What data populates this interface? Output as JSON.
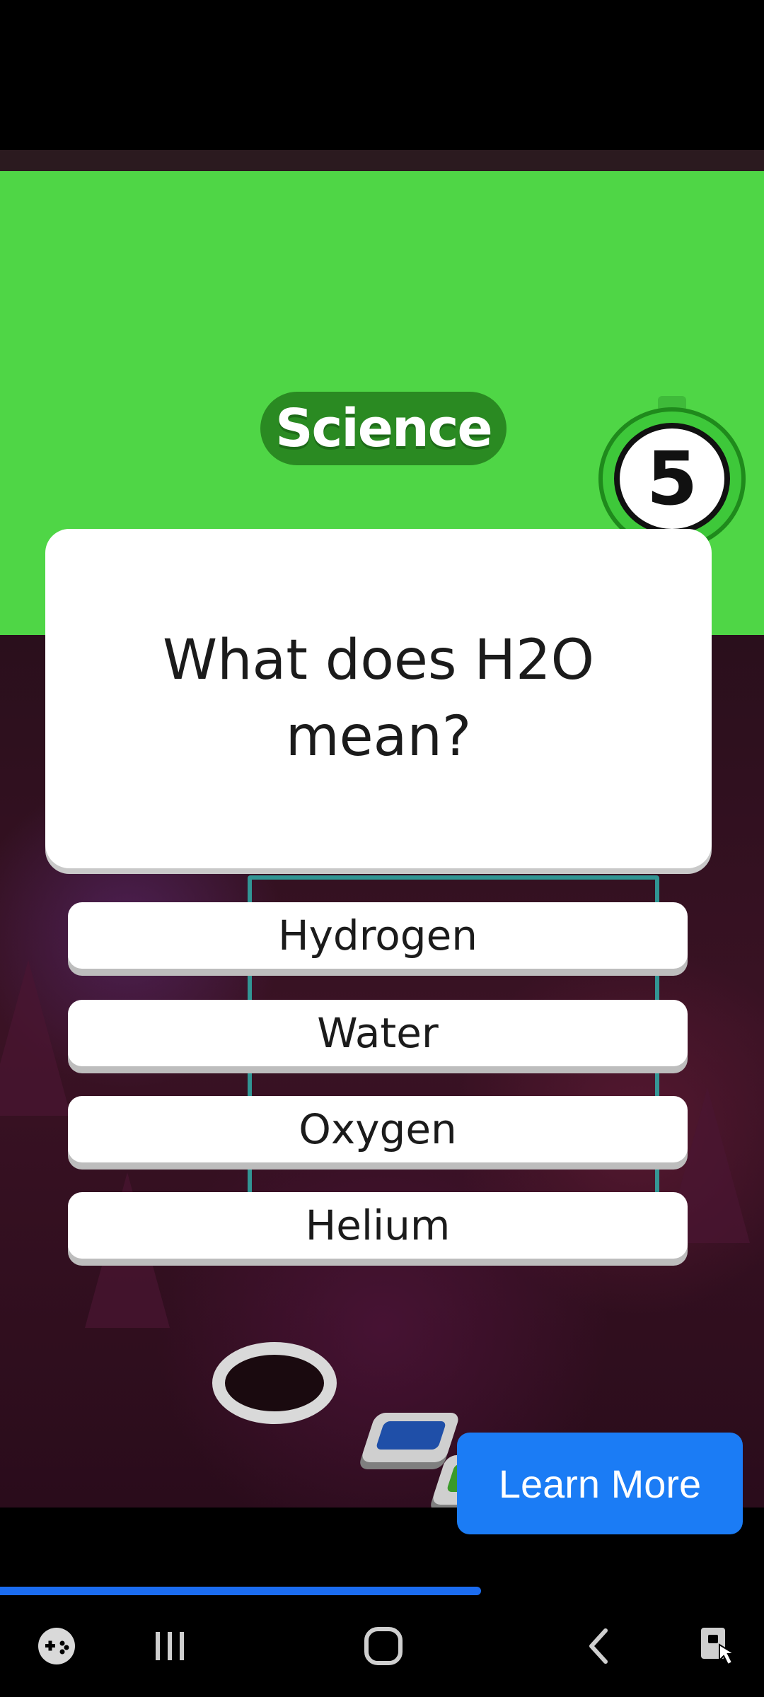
{
  "quiz": {
    "category": "Science",
    "timer": "5",
    "question": "What does H2O mean?",
    "answers": [
      "Hydrogen",
      "Water",
      "Oxygen",
      "Helium"
    ]
  },
  "ad": {
    "cta_label": "Learn More",
    "progress": 0.63
  },
  "nav": {
    "icons": [
      "game-launcher-icon",
      "recent-apps-icon",
      "home-icon",
      "back-icon",
      "screen-lock-icon"
    ]
  },
  "colors": {
    "header_green": "#4fd646",
    "cta_blue": "#1b7cf5",
    "progress_blue": "#1b6cf0"
  }
}
